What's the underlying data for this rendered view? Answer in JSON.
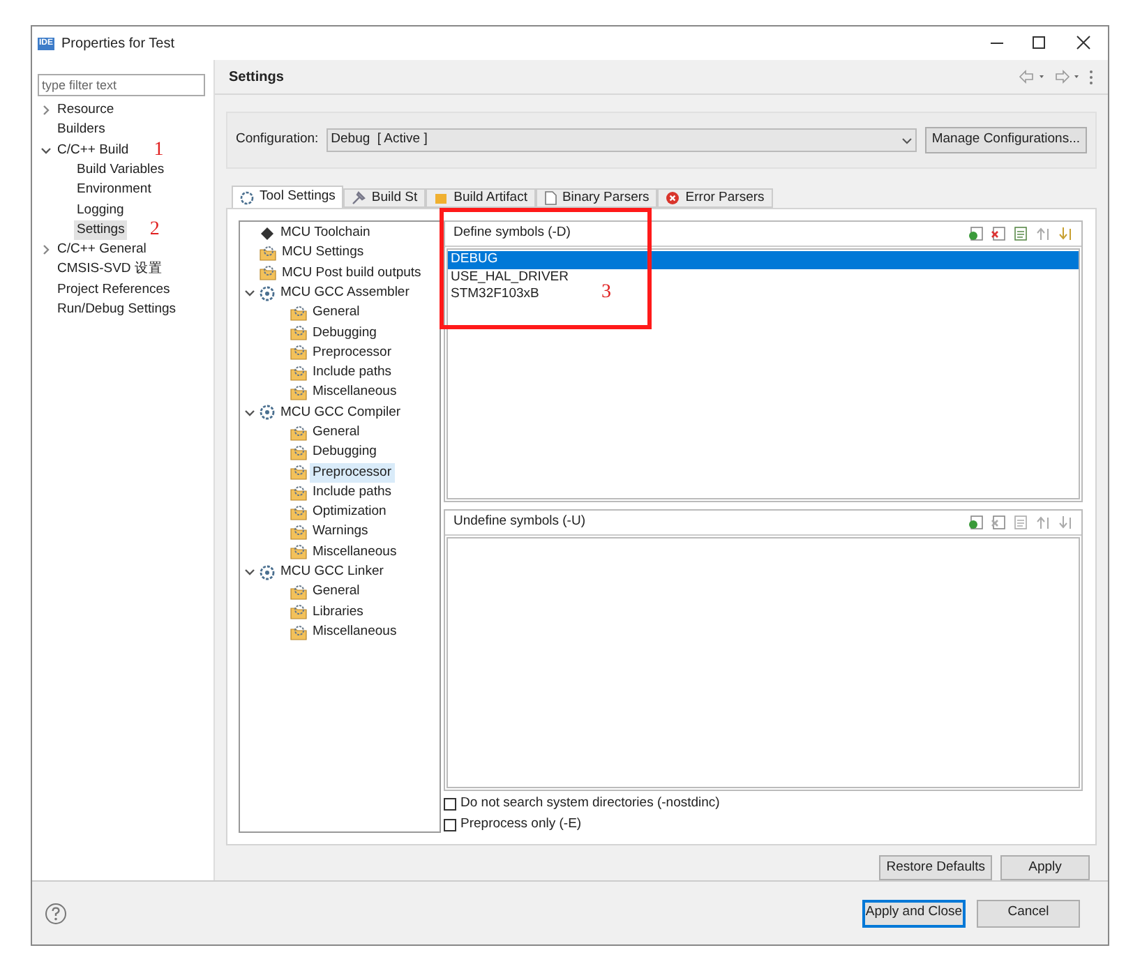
{
  "window": {
    "title": "Properties for Test",
    "app_badge": "IDE"
  },
  "filter": {
    "placeholder": "type filter text"
  },
  "nav": [
    {
      "label": "Resource",
      "expanded": false,
      "selected": false
    },
    {
      "label": "Builders",
      "selected": false
    },
    {
      "label": "C/C++ Build",
      "expanded": true,
      "selected": false,
      "annotation": "1",
      "children": [
        {
          "label": "Build Variables",
          "selected": false
        },
        {
          "label": "Environment",
          "selected": false
        },
        {
          "label": "Logging",
          "selected": false
        },
        {
          "label": "Settings",
          "selected": true,
          "annotation": "2"
        }
      ]
    },
    {
      "label": "C/C++ General",
      "expanded": false,
      "selected": false
    },
    {
      "label": "CMSIS-SVD 设置",
      "selected": false
    },
    {
      "label": "Project References",
      "selected": false
    },
    {
      "label": "Run/Debug Settings",
      "selected": false
    }
  ],
  "page_title": "Settings",
  "configuration": {
    "label": "Configuration:",
    "value": "Debug  [ Active ]",
    "button": "Manage Configurations..."
  },
  "tabs": [
    {
      "label": "Tool Settings",
      "selected": true
    },
    {
      "label": "Build St",
      "selected": false
    },
    {
      "label": "Build Artifact",
      "selected": false
    },
    {
      "label": "Binary Parsers",
      "selected": false
    },
    {
      "label": "Error Parsers",
      "selected": false
    }
  ],
  "tool_tree": [
    {
      "label": "MCU Toolchain",
      "kind": "chip",
      "selected": false
    },
    {
      "label": "MCU Settings",
      "kind": "page",
      "selected": false
    },
    {
      "label": "MCU Post build outputs",
      "kind": "page",
      "selected": false
    },
    {
      "label": "MCU GCC Assembler",
      "kind": "tool",
      "expanded": true,
      "selected": false,
      "children": [
        {
          "label": "General",
          "kind": "page",
          "selected": false
        },
        {
          "label": "Debugging",
          "kind": "page",
          "selected": false
        },
        {
          "label": "Preprocessor",
          "kind": "page",
          "selected": false
        },
        {
          "label": "Include paths",
          "kind": "page",
          "selected": false
        },
        {
          "label": "Miscellaneous",
          "kind": "page",
          "selected": false
        }
      ]
    },
    {
      "label": "MCU GCC Compiler",
      "kind": "tool",
      "expanded": true,
      "selected": false,
      "children": [
        {
          "label": "General",
          "kind": "page",
          "selected": false
        },
        {
          "label": "Debugging",
          "kind": "page",
          "selected": false
        },
        {
          "label": "Preprocessor",
          "kind": "page",
          "selected": true
        },
        {
          "label": "Include paths",
          "kind": "page",
          "selected": false
        },
        {
          "label": "Optimization",
          "kind": "page",
          "selected": false
        },
        {
          "label": "Warnings",
          "kind": "page",
          "selected": false
        },
        {
          "label": "Miscellaneous",
          "kind": "page",
          "selected": false
        }
      ]
    },
    {
      "label": "MCU GCC Linker",
      "kind": "tool",
      "expanded": true,
      "selected": false,
      "children": [
        {
          "label": "General",
          "kind": "page",
          "selected": false
        },
        {
          "label": "Libraries",
          "kind": "page",
          "selected": false
        },
        {
          "label": "Miscellaneous",
          "kind": "page",
          "selected": false
        }
      ]
    }
  ],
  "define_symbols": {
    "title": "Define symbols (-D)",
    "annotation": "3",
    "items": [
      {
        "label": "DEBUG",
        "selected": true
      },
      {
        "label": "USE_HAL_DRIVER",
        "selected": false
      },
      {
        "label": "STM32F103xB",
        "selected": false
      }
    ]
  },
  "undefine_symbols": {
    "title": "Undefine symbols (-U)"
  },
  "options": [
    {
      "label": "Do not search system directories (-nostdinc)",
      "checked": false
    },
    {
      "label": "Preprocess only (-E)",
      "checked": false
    }
  ],
  "page_buttons": [
    "Restore Defaults",
    "Apply"
  ],
  "dialog_buttons": [
    {
      "label": "Apply and Close",
      "default": true
    },
    {
      "label": "Cancel",
      "default": false
    }
  ]
}
